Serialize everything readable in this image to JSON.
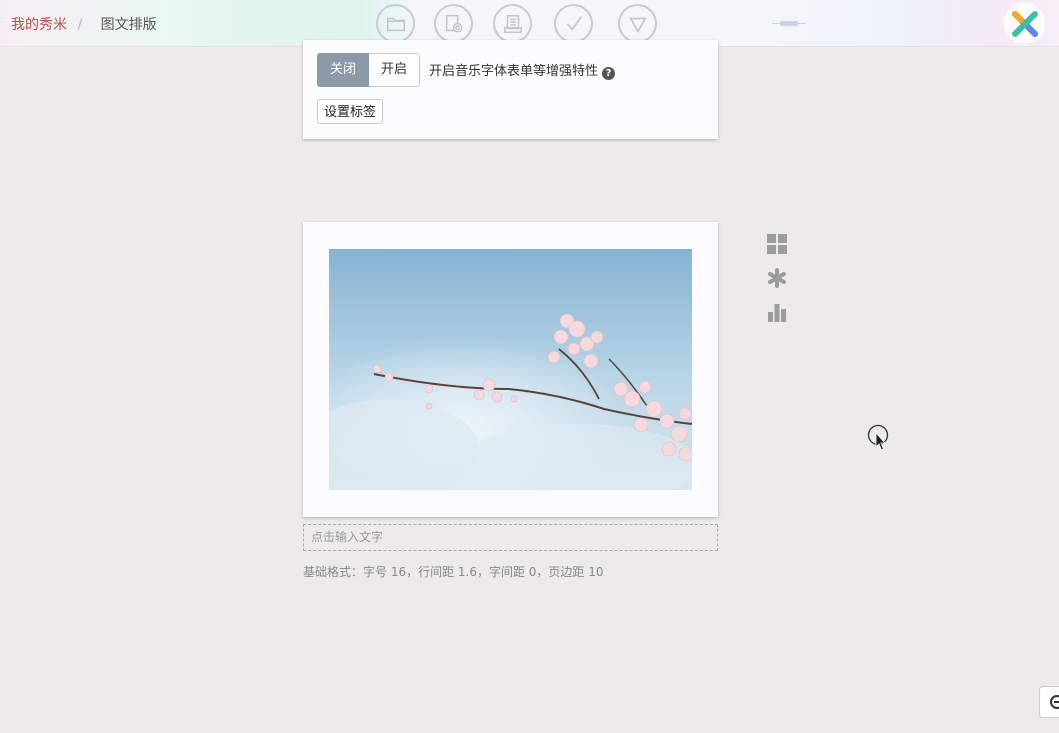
{
  "breadcrumb": {
    "home": "我的秀米",
    "separator": "/",
    "current": "图文排版"
  },
  "toolbar": {
    "icons": [
      "folder-icon",
      "camera-icon",
      "document-icon",
      "check-icon",
      "triangle-icon"
    ]
  },
  "music_toggle": {
    "off_label": "关闭",
    "on_label": "开启",
    "selected": "关闭",
    "description": "开启音乐字体表单等增强特性"
  },
  "tag_button": {
    "label": "设置标签"
  },
  "side_tools": [
    "grid-icon",
    "asterisk-icon",
    "bar-chart-icon"
  ],
  "caption": {
    "placeholder": "点击输入文字"
  },
  "format_info": "基础格式：字号 16，行间距 1.6，字间距 0，页边距 10",
  "colors": {
    "accent": "#c0504d",
    "toggle_selected": "#8c9aa8"
  }
}
